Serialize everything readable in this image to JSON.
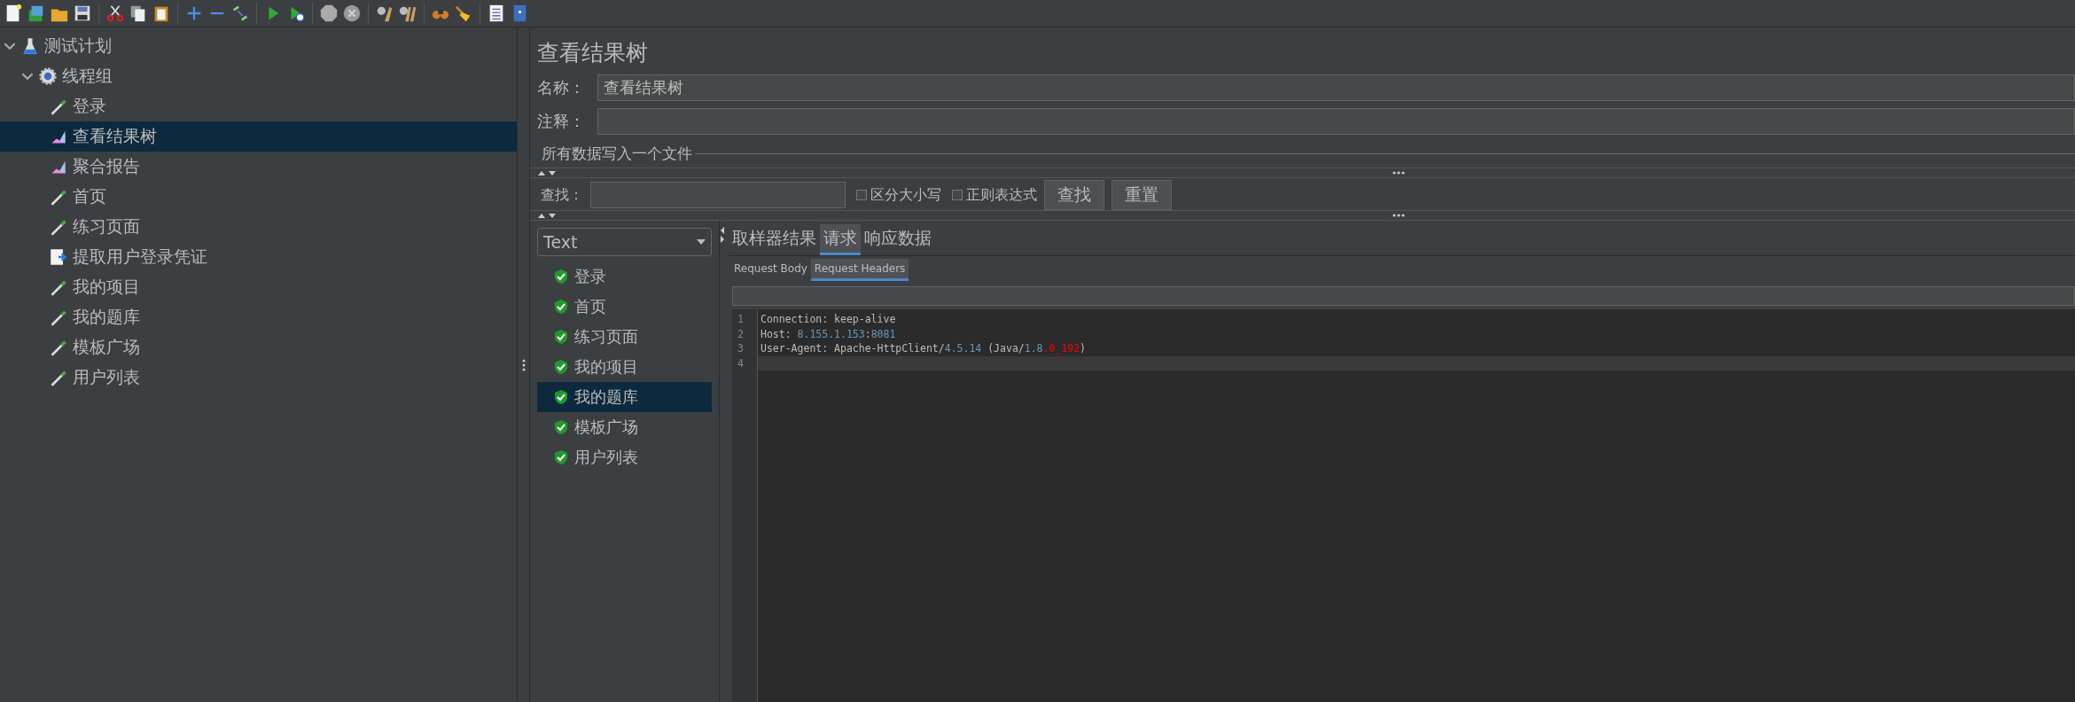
{
  "tree": [
    {
      "label": "测试计划",
      "kind": "plan",
      "expanded": true,
      "selected": false,
      "children": [
        {
          "label": "线程组",
          "kind": "group",
          "expanded": true,
          "selected": false,
          "children": [
            {
              "label": "登录",
              "kind": "sampler",
              "selected": false
            },
            {
              "label": "查看结果树",
              "kind": "listener",
              "selected": true
            },
            {
              "label": "聚合报告",
              "kind": "listener",
              "selected": false
            },
            {
              "label": "首页",
              "kind": "sampler",
              "selected": false
            },
            {
              "label": "练习页面",
              "kind": "sampler",
              "selected": false
            },
            {
              "label": "提取用户登录凭证",
              "kind": "extractor",
              "selected": false
            },
            {
              "label": "我的项目",
              "kind": "sampler",
              "selected": false
            },
            {
              "label": "我的题库",
              "kind": "sampler",
              "selected": false
            },
            {
              "label": "模板广场",
              "kind": "sampler",
              "selected": false
            },
            {
              "label": "用户列表",
              "kind": "sampler",
              "selected": false
            }
          ]
        }
      ]
    }
  ],
  "title": "查看结果树",
  "name_field": {
    "label": "名称：",
    "value": "查看结果树"
  },
  "comment_field": {
    "label": "注释："
  },
  "file_section": {
    "legend": "所有数据写入一个文件"
  },
  "search": {
    "label": "查找：",
    "options": [
      {
        "label": "区分大小写",
        "checked": false
      },
      {
        "label": "正则表达式",
        "checked": false
      }
    ],
    "buttons": [
      "查找",
      "重置"
    ]
  },
  "renderer": {
    "value": "Text"
  },
  "results": [
    {
      "label": "登录",
      "selected": false
    },
    {
      "label": "首页",
      "selected": false
    },
    {
      "label": "练习页面",
      "selected": false
    },
    {
      "label": "我的项目",
      "selected": false
    },
    {
      "label": "我的题库",
      "selected": true
    },
    {
      "label": "模板广场",
      "selected": false
    },
    {
      "label": "用户列表",
      "selected": false
    }
  ],
  "tabs": [
    {
      "label": "取样器结果",
      "selected": false
    },
    {
      "label": "请求",
      "selected": true
    },
    {
      "label": "响应数据",
      "selected": false
    }
  ],
  "subtabs": [
    {
      "label": "Request Body",
      "selected": false
    },
    {
      "label": "Request Headers",
      "selected": true
    }
  ],
  "code_lines": [
    {
      "number": "1",
      "current": false,
      "segments": [
        {
          "text": "Connection: keep-alive",
          "kind": "plain"
        }
      ]
    },
    {
      "number": "2",
      "current": false,
      "segments": [
        {
          "text": "Host: ",
          "kind": "plain"
        },
        {
          "text": "8.155.1.153",
          "kind": "number"
        },
        {
          "text": ":",
          "kind": "plain"
        },
        {
          "text": "8081",
          "kind": "number"
        }
      ]
    },
    {
      "number": "3",
      "current": false,
      "segments": [
        {
          "text": "User-Agent: Apache-HttpClient/",
          "kind": "plain"
        },
        {
          "text": "4.5.14",
          "kind": "number"
        },
        {
          "text": " (Java/",
          "kind": "plain"
        },
        {
          "text": "1.8",
          "kind": "number"
        },
        {
          "text": ".0_192",
          "kind": "error"
        },
        {
          "text": ")",
          "kind": "plain"
        }
      ]
    },
    {
      "number": "4",
      "current": true
    }
  ]
}
